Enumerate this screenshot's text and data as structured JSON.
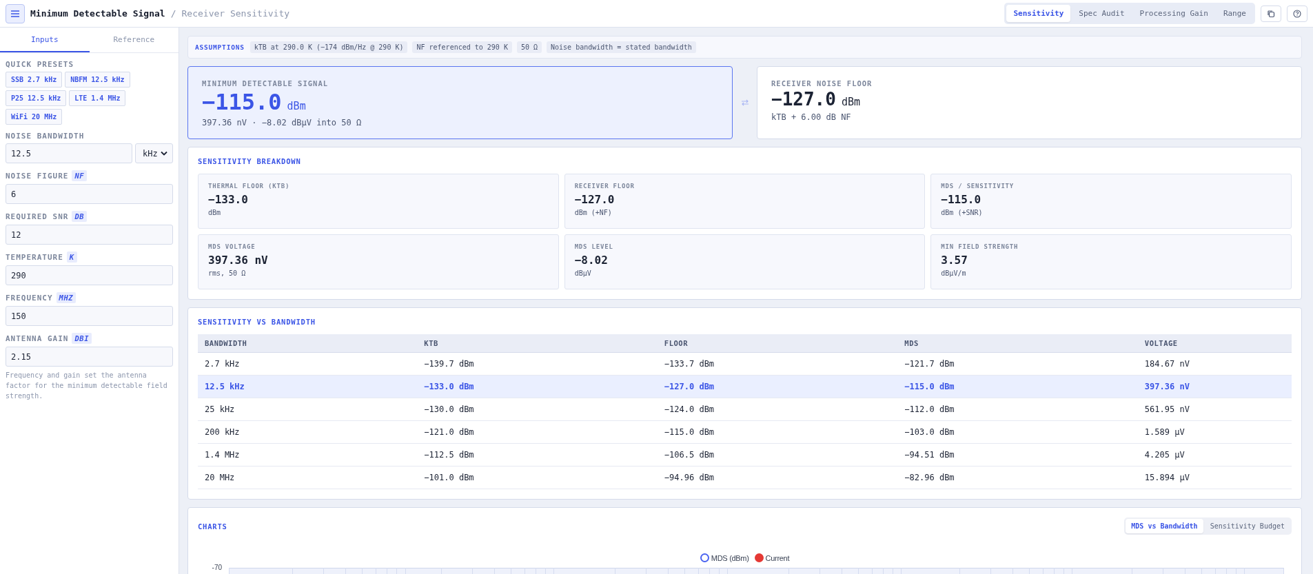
{
  "header": {
    "title": "Minimum Detectable Signal",
    "separator": "/",
    "subtitle": "Receiver Sensitivity"
  },
  "mode_tabs": [
    {
      "label": "Sensitivity",
      "selected": true
    },
    {
      "label": "Spec Audit",
      "selected": false
    },
    {
      "label": "Processing Gain",
      "selected": false
    },
    {
      "label": "Range",
      "selected": false
    }
  ],
  "sidebar": {
    "tabs": [
      {
        "label": "Inputs",
        "selected": true
      },
      {
        "label": "Reference",
        "selected": false
      }
    ],
    "presets_label": "QUICK PRESETS",
    "presets": [
      "SSB 2.7 kHz",
      "NBFM 12.5 kHz",
      "P25 12.5 kHz",
      "LTE 1.4 MHz",
      "WiFi 20 MHz"
    ],
    "fields": [
      {
        "label": "NOISE BANDWIDTH",
        "value": "12.5",
        "select": "kHz"
      },
      {
        "label": "NOISE FIGURE",
        "unit": "NF",
        "value": "6"
      },
      {
        "label": "REQUIRED SNR",
        "unit": "DB",
        "value": "12"
      },
      {
        "label": "TEMPERATURE",
        "unit": "K",
        "value": "290"
      },
      {
        "label": "FREQUENCY",
        "unit": "MHZ",
        "value": "150"
      },
      {
        "label": "ANTENNA GAIN",
        "unit": "DBI",
        "value": "2.15"
      }
    ],
    "note": "Frequency and gain set the antenna factor for the minimum detectable field strength."
  },
  "assumptions": {
    "label": "ASSUMPTIONS",
    "chips": [
      "kTB at 290.0 K (−174 dBm/Hz @ 290 K)",
      "NF referenced to 290 K",
      "50 Ω",
      "Noise bandwidth = stated bandwidth"
    ]
  },
  "hero_cards": [
    {
      "kind": "primary",
      "label": "MINIMUM DETECTABLE SIGNAL",
      "value": "−115.0",
      "unit": "dBm",
      "detail": "397.36 nV · −8.02 dBµV into 50 Ω"
    },
    {
      "kind": "plain",
      "label": "RECEIVER NOISE FLOOR",
      "value": "−127.0",
      "unit": "dBm",
      "detail": "kTB + 6.00 dB NF"
    }
  ],
  "breakdown": {
    "title": "SENSITIVITY BREAKDOWN",
    "tiles": [
      {
        "label": "THERMAL FLOOR (KTB)",
        "value": "−133.0",
        "unit": "dBm"
      },
      {
        "label": "RECEIVER FLOOR",
        "value": "−127.0",
        "unit": "dBm (+NF)"
      },
      {
        "label": "MDS / SENSITIVITY",
        "value": "−115.0",
        "unit": "dBm (+SNR)"
      },
      {
        "label": "MDS VOLTAGE",
        "value": "397.36 nV",
        "unit": "rms, 50 Ω"
      },
      {
        "label": "MDS LEVEL",
        "value": "−8.02",
        "unit": "dBµV"
      },
      {
        "label": "MIN FIELD STRENGTH",
        "value": "3.57",
        "unit": "dBµV/m"
      }
    ]
  },
  "table": {
    "title": "SENSITIVITY VS BANDWIDTH",
    "columns": [
      "BANDWIDTH",
      "KTB",
      "FLOOR",
      "MDS",
      "VOLTAGE"
    ],
    "rows": [
      {
        "cells": [
          "2.7 kHz",
          "−139.7 dBm",
          "−133.7 dBm",
          "−121.7 dBm",
          "184.67 nV"
        ],
        "selected": false
      },
      {
        "cells": [
          "12.5 kHz",
          "−133.0 dBm",
          "−127.0 dBm",
          "−115.0 dBm",
          "397.36 nV"
        ],
        "selected": true
      },
      {
        "cells": [
          "25 kHz",
          "−130.0 dBm",
          "−124.0 dBm",
          "−112.0 dBm",
          "561.95 nV"
        ],
        "selected": false
      },
      {
        "cells": [
          "200 kHz",
          "−121.0 dBm",
          "−115.0 dBm",
          "−103.0 dBm",
          "1.589 µV"
        ],
        "selected": false
      },
      {
        "cells": [
          "1.4 MHz",
          "−112.5 dBm",
          "−106.5 dBm",
          "−94.51 dBm",
          "4.205 µV"
        ],
        "selected": false
      },
      {
        "cells": [
          "20 MHz",
          "−101.0 dBm",
          "−94.96 dBm",
          "−82.96 dBm",
          "15.894 µV"
        ],
        "selected": false
      }
    ]
  },
  "charts": {
    "title": "CHARTS",
    "tabs": [
      {
        "label": "MDS vs Bandwidth",
        "selected": true
      },
      {
        "label": "Sensitivity Budget",
        "selected": false
      }
    ],
    "legend": [
      {
        "label": "MDS (dBm)",
        "kind": "outline",
        "color": "#4a63f0"
      },
      {
        "label": "Current",
        "kind": "filled",
        "color": "#e53935"
      }
    ],
    "y_tick_label": "-70"
  }
}
